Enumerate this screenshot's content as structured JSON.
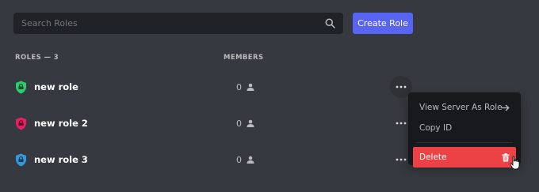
{
  "search": {
    "placeholder": "Search Roles"
  },
  "toolbar": {
    "create_label": "Create Role"
  },
  "table": {
    "roles_header": "ROLES — 3",
    "members_header": "MEMBERS"
  },
  "roles": [
    {
      "name": "new role",
      "members": "0",
      "color": "#2ecc71"
    },
    {
      "name": "new role 2",
      "members": "0",
      "color": "#e91e63"
    },
    {
      "name": "new role 3",
      "members": "0",
      "color": "#3498db"
    }
  ],
  "context_menu": {
    "items": [
      {
        "label": "View Server As Role",
        "icon": "arrow-right-icon"
      },
      {
        "label": "Copy ID"
      },
      {
        "label": "Delete",
        "icon": "trash-icon",
        "danger": true
      }
    ]
  },
  "colors": {
    "background": "#36393f",
    "search_bg": "#202225",
    "accent": "#5865f2",
    "danger": "#ed4245",
    "menu_bg": "#18191c"
  },
  "icons": [
    "search-icon",
    "shield-icon",
    "member-icon",
    "more-icon",
    "arrow-right-icon",
    "trash-icon",
    "cursor-icon"
  ]
}
